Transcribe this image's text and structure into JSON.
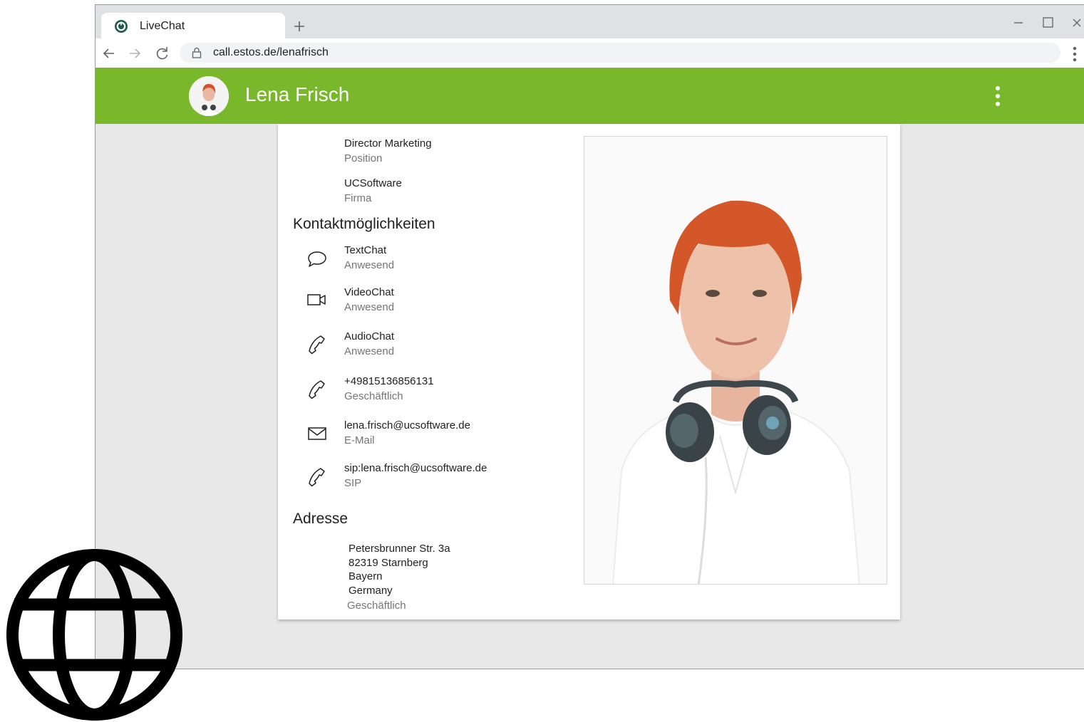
{
  "browser": {
    "tab_title": "LiveChat",
    "url": "call.estos.de/lenafrisch"
  },
  "header": {
    "name": "Lena Frisch"
  },
  "profile": {
    "position": {
      "value": "Director Marketing",
      "label": "Position"
    },
    "company": {
      "value": "UCSoftware",
      "label": "Firma"
    }
  },
  "contact": {
    "heading": "Kontaktmöglichkeiten",
    "items": [
      {
        "value": "TextChat",
        "label": "Anwesend",
        "icon": "chat-bubble-icon"
      },
      {
        "value": "VideoChat",
        "label": "Anwesend",
        "icon": "video-camera-icon"
      },
      {
        "value": "AudioChat",
        "label": "Anwesend",
        "icon": "phone-icon"
      },
      {
        "value": "+49815136856131",
        "label": "Geschäftlich",
        "icon": "phone-icon"
      },
      {
        "value": "lena.frisch@ucsoftware.de",
        "label": "E-Mail",
        "icon": "envelope-icon"
      },
      {
        "value": "sip:lena.frisch@ucsoftware.de",
        "label": "SIP",
        "icon": "phone-icon"
      }
    ]
  },
  "address": {
    "heading": "Adresse",
    "lines": [
      "Petersbrunner Str. 3a",
      "82319 Starnberg",
      "Bayern",
      "Germany"
    ],
    "label": "Geschäftlich"
  },
  "colors": {
    "appbar": "#78b82a",
    "page_bg": "#e8e8e8"
  }
}
